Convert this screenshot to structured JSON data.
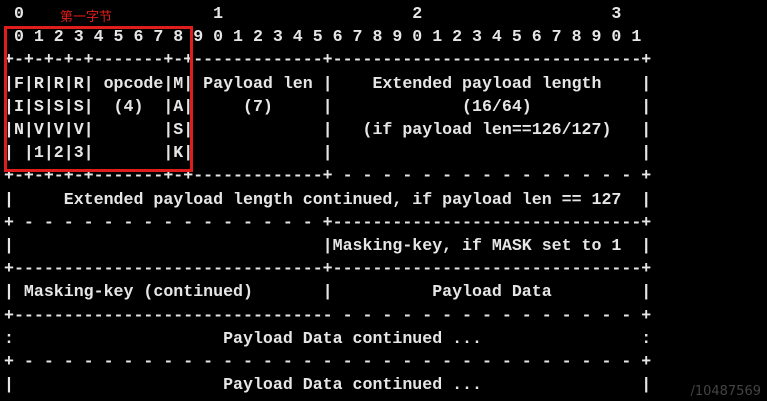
{
  "diagram": {
    "annotation": "第一字节",
    "watermark": "/10487569",
    "lines": [
      " 0                   1                   2                   3",
      " 0 1 2 3 4 5 6 7 8 9 0 1 2 3 4 5 6 7 8 9 0 1 2 3 4 5 6 7 8 9 0 1",
      "+-+-+-+-+-------+-+-------------+-------------------------------+",
      "|F|R|R|R| opcode|M| Payload len |    Extended payload length    |",
      "|I|S|S|S|  (4)  |A|     (7)     |             (16/64)           |",
      "|N|V|V|V|       |S|             |   (if payload len==126/127)   |",
      "| |1|2|3|       |K|             |                               |",
      "+-+-+-+-+-------+-+-------------+ - - - - - - - - - - - - - - - +",
      "|     Extended payload length continued, if payload len == 127  |",
      "+ - - - - - - - - - - - - - - - +-------------------------------+",
      "|                               |Masking-key, if MASK set to 1  |",
      "+-------------------------------+-------------------------------+",
      "| Masking-key (continued)       |          Payload Data         |",
      "+-------------------------------- - - - - - - - - - - - - - - - +",
      ":                     Payload Data continued ...                :",
      "+ - - - - - - - - - - - - - - - - - - - - - - - - - - - - - - - +",
      "|                     Payload Data continued ...                |"
    ]
  }
}
